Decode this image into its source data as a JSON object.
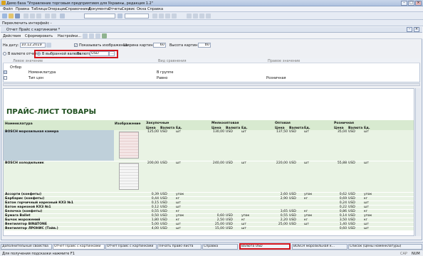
{
  "window": {
    "title": "Демо база \"Управление торговым предприятием для Украины, редакция 1.2\""
  },
  "menu": [
    "Файл",
    "Правка",
    "Таблица",
    "Операции",
    "Справочники",
    "Документы",
    "Отчеты",
    "Сервис",
    "Окна",
    "Справка"
  ],
  "switcher_label": "Переключить интерфейс -",
  "doc": {
    "title": "Отчет  Прайс с картинками *",
    "toolbar": {
      "actions": "Действия",
      "generate": "Сформировать",
      "settings": "Настройки..."
    }
  },
  "params": {
    "date_label": "На дату:",
    "date_value": "10.12.2019",
    "show_images_label": "Показывать изображение",
    "show_images_checked": true,
    "width_label": "Ширина картинки:",
    "width_value": "60",
    "height_label": "Высота картинки:",
    "height_value": "80",
    "in_report_currency": "В валюте отчета",
    "in_selected_currency": "В выбранной валюте",
    "currency_label": "Валюта",
    "currency_value": "USD"
  },
  "filter": {
    "columns": [
      "Левое значение",
      "Вид сравнения",
      "Правое значение"
    ],
    "rows": [
      {
        "left": "Отбор",
        "cmp": "",
        "right": ""
      },
      {
        "left": "Номенклатура",
        "cmp": "В группе",
        "right": ""
      },
      {
        "left": "Тип цен",
        "cmp": "Равно",
        "right": "Розничная"
      }
    ]
  },
  "report": {
    "title": "ПРАЙС-ЛИСТ ТОВАРЫ",
    "col_product": "Номенклатура",
    "col_image": "Изображение",
    "price_groups": [
      "Закупочные",
      "Мелкооптовая",
      "Оптовая",
      "Розничная"
    ],
    "subcols": [
      "Цена",
      "Валюта",
      "Ед."
    ],
    "rows": [
      {
        "name": "BOSCH морозильная камера",
        "p": [
          [
            "125,00",
            "USD",
            "шт"
          ],
          [
            "130,00",
            "USD",
            "шт"
          ],
          [
            "137,50",
            "USD",
            "шт"
          ],
          [
            "35,04",
            "USD",
            "шт"
          ]
        ]
      },
      {
        "name": "BOSCH холодильник",
        "p": [
          [
            "200,00",
            "USD",
            "шт"
          ],
          [
            "240,00",
            "USD",
            "шт"
          ],
          [
            "220,00",
            "USD",
            "шт"
          ],
          [
            "55,88",
            "USD",
            "шт"
          ]
        ]
      },
      {
        "name": "Ассорти (конфеты)",
        "p": [
          [
            "0,39",
            "USD",
            "упак"
          ],
          [
            "",
            "",
            ""
          ],
          [
            "2,60",
            "USD",
            "упак"
          ],
          [
            "0,62",
            "USD",
            "упак"
          ]
        ]
      },
      {
        "name": "Барбарис (конфеты)",
        "p": [
          [
            "0,44",
            "USD",
            "кг"
          ],
          [
            "",
            "",
            ""
          ],
          [
            "2,90",
            "USD",
            "кг"
          ],
          [
            "0,69",
            "USD",
            "кг"
          ]
        ]
      },
      {
        "name": "Батон горчичный нарезный КХЗ №1",
        "p": [
          [
            "0,15",
            "USD",
            "шт"
          ],
          [
            "",
            "",
            ""
          ],
          [
            "",
            "",
            ""
          ],
          [
            "0,24",
            "USD",
            "шт"
          ]
        ]
      },
      {
        "name": "Батон нарезной КХЗ №1",
        "p": [
          [
            "0,12",
            "USD",
            "шт"
          ],
          [
            "",
            "",
            ""
          ],
          [
            "",
            "",
            ""
          ],
          [
            "0,22",
            "USD",
            "шт"
          ]
        ]
      },
      {
        "name": "Белочка (конфеты)",
        "p": [
          [
            "0,55",
            "USD",
            "кг"
          ],
          [
            "",
            "",
            ""
          ],
          [
            "3,65",
            "USD",
            "кг"
          ],
          [
            "0,86",
            "USD",
            "кг"
          ]
        ]
      },
      {
        "name": "Бумага Ballet",
        "p": [
          [
            "0,50",
            "USD",
            "упак"
          ],
          [
            "0,60",
            "USD",
            "упак"
          ],
          [
            "0,55",
            "USD",
            "упак"
          ],
          [
            "0,14",
            "USD",
            "упак"
          ]
        ]
      },
      {
        "name": "Бычок морожений",
        "p": [
          [
            "1,80",
            "USD",
            "кг"
          ],
          [
            "2,50",
            "USD",
            "кг"
          ],
          [
            "2,20",
            "USD",
            "кг"
          ],
          [
            "3,50",
            "USD",
            "кг"
          ]
        ]
      },
      {
        "name": "Вентилятор BINATONE",
        "p": [
          [
            "5,00",
            "USD",
            "шт"
          ],
          [
            "25,00",
            "USD",
            "шт"
          ],
          [
            "25,00",
            "USD",
            "шт"
          ],
          [
            "1,40",
            "USD",
            "шт"
          ]
        ]
      },
      {
        "name": "Вентилятор ЛРОНИС (Тайв.)",
        "p": [
          [
            "4,00",
            "USD",
            "шт"
          ],
          [
            "15,00",
            "USD",
            "шт"
          ],
          [
            "",
            "",
            ""
          ],
          [
            "0,60",
            "USD",
            "шт"
          ]
        ]
      }
    ]
  },
  "taskbar": [
    "Дополнительные свойства",
    "Отчет  Прайс с картинками",
    "Отчет  Прайс с картинками",
    "Печать прайс-листа",
    "Справка",
    "Валюта  USD",
    "BOSCH морозильная к...",
    "Список (Цены номенклатуры)"
  ],
  "status": {
    "hint": "Для получения подсказки нажмите F1",
    "caps": "CAP",
    "num": "NUM"
  }
}
